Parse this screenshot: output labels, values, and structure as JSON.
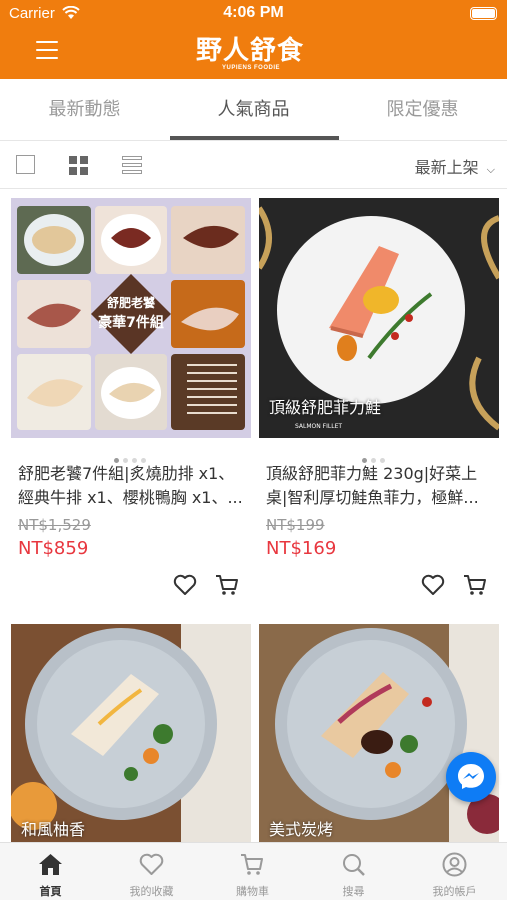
{
  "status_bar": {
    "carrier": "Carrier",
    "time": "4:06 PM"
  },
  "header": {
    "brand": "野人舒食",
    "tagline": "YUPIENS FOODIE"
  },
  "tabs": [
    {
      "label": "最新動態",
      "active": false
    },
    {
      "label": "人氣商品",
      "active": true
    },
    {
      "label": "限定優惠",
      "active": false
    }
  ],
  "view_bar": {
    "sort_label": "最新上架"
  },
  "products": [
    {
      "name": "舒肥老饕7件組|炙燒肋排 x1、經典牛排 x1、櫻桃鴨胸 x1、...",
      "original_price": "NT$1,529",
      "sale_price": "NT$859",
      "image_badge_top": "舒肥老饕",
      "image_badge_main": "豪華7件組"
    },
    {
      "name": "頂級舒肥菲力鮭 230g|好菜上桌|智利厚切鮭魚菲力，極鮮...",
      "original_price": "NT$199",
      "sale_price": "NT$169",
      "image_caption": "頂級舒肥菲力鮭",
      "image_caption_sub": "SALMON FILLET"
    },
    {
      "image_caption": "和風柚香"
    },
    {
      "image_caption": "美式炭烤"
    }
  ],
  "bottom_nav": [
    {
      "label": "首頁",
      "icon": "home-icon",
      "active": true
    },
    {
      "label": "我的收藏",
      "icon": "heart-icon",
      "active": false
    },
    {
      "label": "購物車",
      "icon": "cart-icon",
      "active": false
    },
    {
      "label": "搜尋",
      "icon": "search-icon",
      "active": false
    },
    {
      "label": "我的帳戶",
      "icon": "account-icon",
      "active": false
    }
  ],
  "colors": {
    "brand_orange": "#f07d0e",
    "price_red": "#e8373f",
    "messenger_blue": "#0e7cf5"
  }
}
